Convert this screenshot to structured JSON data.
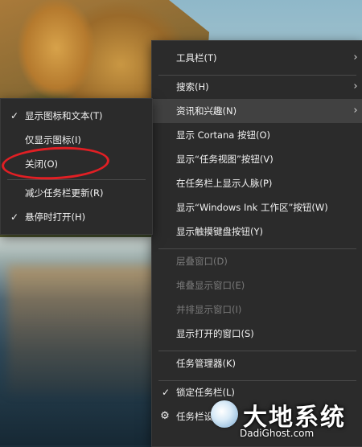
{
  "main_menu": {
    "items": [
      {
        "label": "工具栏(T)",
        "has_submenu": true
      },
      {
        "label": "搜索(H)",
        "has_submenu": true
      },
      {
        "label": "资讯和兴趣(N)",
        "has_submenu": true
      },
      {
        "label": "显示 Cortana 按钮(O)"
      },
      {
        "label": "显示“任务视图”按钮(V)"
      },
      {
        "label": "在任务栏上显示人脉(P)"
      },
      {
        "label": "显示“Windows Ink 工作区”按钮(W)"
      },
      {
        "label": "显示触摸键盘按钮(Y)"
      },
      {
        "label": "层叠窗口(D)",
        "disabled": true
      },
      {
        "label": "堆叠显示窗口(E)",
        "disabled": true
      },
      {
        "label": "并排显示窗口(I)",
        "disabled": true
      },
      {
        "label": "显示打开的窗口(S)"
      },
      {
        "label": "任务管理器(K)"
      },
      {
        "label": "锁定任务栏(L)",
        "checked": true
      },
      {
        "label": "任务栏设置(T)"
      }
    ]
  },
  "sub_menu": {
    "items": [
      {
        "label": "显示图标和文本(T)",
        "checked": true
      },
      {
        "label": "仅显示图标(I)"
      },
      {
        "label": "关闭(O)"
      },
      {
        "label": "减少任务栏更新(R)"
      },
      {
        "label": "悬停时打开(H)",
        "checked": true
      }
    ]
  },
  "icons": {
    "submenu_arrow": "chevron-right-icon",
    "check": "checkmark-icon",
    "settings": "gear-icon",
    "watermark_logo": "logo-icon"
  },
  "colors": {
    "menu_bg": "#2b2b2b",
    "menu_highlight": "#414141",
    "text": "#f2f2f2",
    "disabled_text": "#7a7a7a",
    "annotation_red": "#e11f24"
  },
  "watermark": {
    "title": "大地系统",
    "url": "DadiGhost.com"
  }
}
